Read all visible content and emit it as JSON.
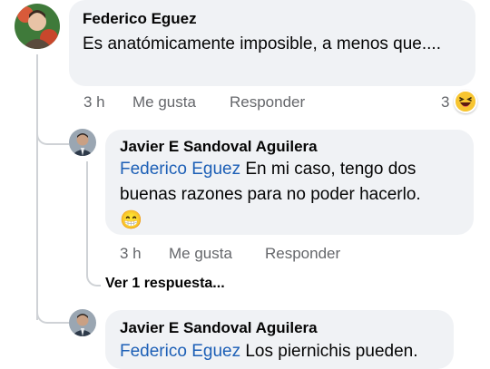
{
  "comment1": {
    "author": "Federico Eguez",
    "text": "Es anatómicamente imposible, a menos que....",
    "time": "3 h",
    "like": "Me gusta",
    "reply": "Responder",
    "reaction_count": "3",
    "reaction_icon": "laughing-emoji-icon"
  },
  "reply1": {
    "author": "Javier E Sandoval Aguilera",
    "mention": "Federico Eguez",
    "text_line1": " En mi caso, tengo dos",
    "text_line2": "buenas razones para no poder hacerlo.",
    "emoji": "😁",
    "time": "3 h",
    "like": "Me gusta",
    "reply": "Responder",
    "view_replies": "Ver 1 respuesta..."
  },
  "reply2": {
    "author": "Javier E Sandoval Aguilera",
    "mention": "Federico Eguez",
    "text": " Los piernichis pueden."
  }
}
